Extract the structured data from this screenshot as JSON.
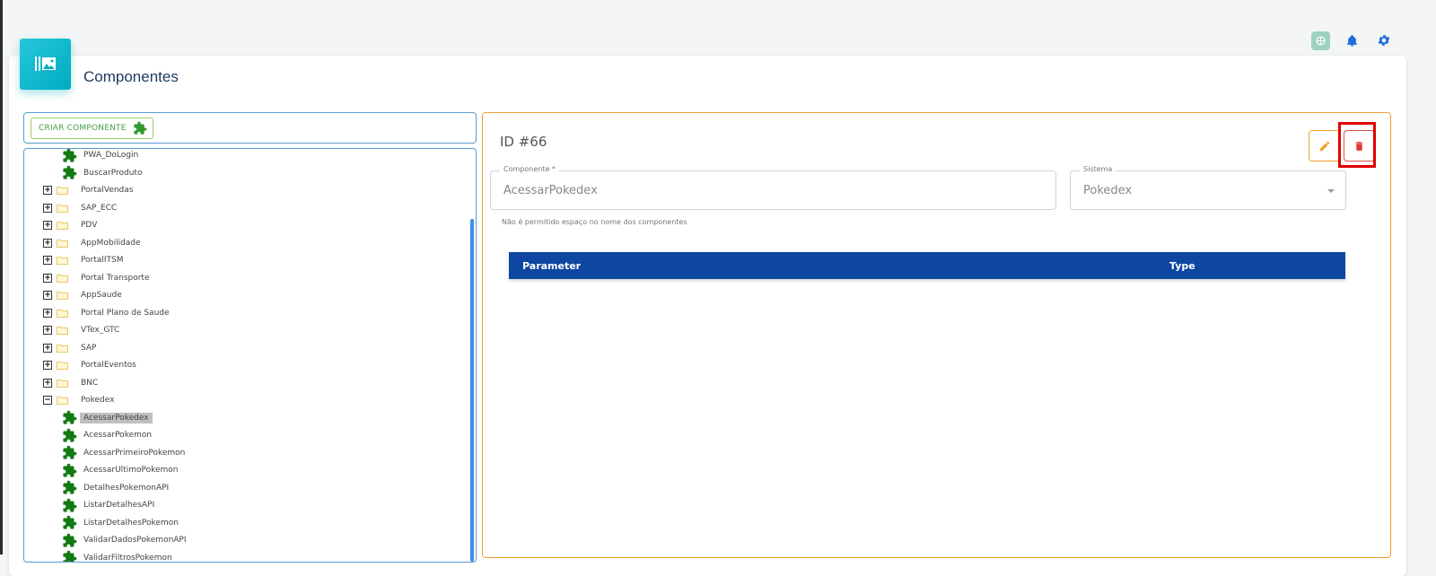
{
  "topbar": {
    "icons": [
      "chatgpt-icon",
      "bell-icon",
      "gear-icon"
    ]
  },
  "page": {
    "title": "Componentes",
    "icon": "gallery-icon"
  },
  "create": {
    "label": "CRIAR COMPONENTE",
    "icon": "puzzle-icon"
  },
  "tree": {
    "items": [
      {
        "type": "component",
        "label": "PWA_DoLogin"
      },
      {
        "type": "component",
        "label": "BuscarProduto"
      },
      {
        "type": "folder",
        "label": "PortalVendas",
        "expanded": false
      },
      {
        "type": "folder",
        "label": "SAP_ECC",
        "expanded": false
      },
      {
        "type": "folder",
        "label": "PDV",
        "expanded": false
      },
      {
        "type": "folder",
        "label": "AppMobilidade",
        "expanded": false
      },
      {
        "type": "folder",
        "label": "PortalITSM",
        "expanded": false
      },
      {
        "type": "folder",
        "label": "Portal Transporte",
        "expanded": false
      },
      {
        "type": "folder",
        "label": "AppSaude",
        "expanded": false
      },
      {
        "type": "folder",
        "label": "Portal Plano de Saude",
        "expanded": false
      },
      {
        "type": "folder",
        "label": "VTex_GTC",
        "expanded": false
      },
      {
        "type": "folder",
        "label": "SAP",
        "expanded": false
      },
      {
        "type": "folder",
        "label": "PortalEventos",
        "expanded": false
      },
      {
        "type": "folder",
        "label": "BNC",
        "expanded": false
      },
      {
        "type": "folder",
        "label": "Pokedex",
        "expanded": true
      },
      {
        "type": "component",
        "label": "AcessarPokedex",
        "selected": true
      },
      {
        "type": "component",
        "label": "AcessarPokemon"
      },
      {
        "type": "component",
        "label": "AcessarPrimeiroPokemon"
      },
      {
        "type": "component",
        "label": "AcessarUltimoPokemon"
      },
      {
        "type": "component",
        "label": "DetalhesPokemonAPI"
      },
      {
        "type": "component",
        "label": "ListarDetalhesAPI"
      },
      {
        "type": "component",
        "label": "ListarDetalhesPokemon"
      },
      {
        "type": "component",
        "label": "ValidarDadosPokemonAPI"
      },
      {
        "type": "component",
        "label": "ValidarFiltrosPokemon"
      }
    ]
  },
  "detail": {
    "id_label": "ID #66",
    "componente_label": "Componente *",
    "componente_value": "AcessarPokedex",
    "sistema_label": "Sistema",
    "sistema_value": "Pokedex",
    "hint": "Não é permitido espaço no nome dos componentes",
    "table_headers": [
      "Parameter",
      "Type"
    ]
  },
  "colors": {
    "accent_cyan": "#00acc1",
    "table_header": "#0d47a1",
    "puzzle_green": "#1b8a1b",
    "edit_orange": "#f0a030",
    "delete_red": "#d9534f"
  }
}
